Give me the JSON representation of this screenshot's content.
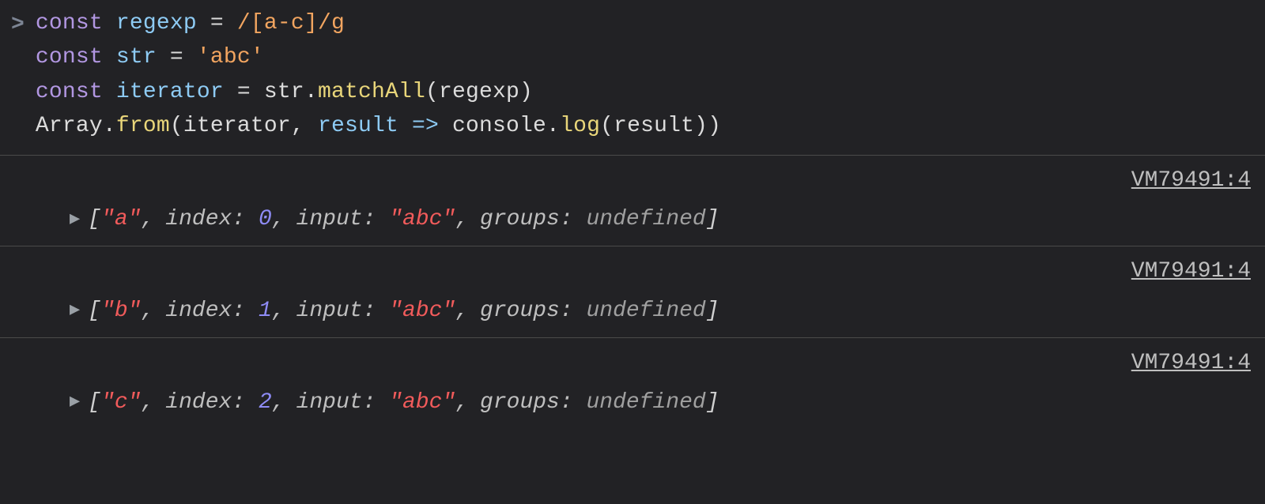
{
  "input": {
    "line1": {
      "kw1": "const",
      "v1": "regexp",
      "eq": "=",
      "regex": "/[a-c]/g"
    },
    "line2": {
      "kw1": "const",
      "v1": "str",
      "eq": "=",
      "str": "'abc'"
    },
    "line3": {
      "kw1": "const",
      "v1": "iterator",
      "eq": "=",
      "obj": "str",
      "dot": ".",
      "fn": "matchAll",
      "open": "(",
      "arg": "regexp",
      "close": ")"
    },
    "line4": {
      "obj": "Array",
      "dot1": ".",
      "fn1": "from",
      "open": "(",
      "arg1": "iterator",
      "c": ",",
      "arg2": "result",
      "arrow": "=>",
      "obj2": "console",
      "dot2": ".",
      "fn2": "log",
      "open2": "(",
      "arg3": "result",
      "close2": ")",
      "close": ")"
    }
  },
  "source_link": "VM79491:4",
  "logs": [
    {
      "match": "\"a\"",
      "index": "0",
      "input": "\"abc\"",
      "groups": "undefined"
    },
    {
      "match": "\"b\"",
      "index": "1",
      "input": "\"abc\"",
      "groups": "undefined"
    },
    {
      "match": "\"c\"",
      "index": "2",
      "input": "\"abc\"",
      "groups": "undefined"
    }
  ],
  "labels": {
    "index": "index:",
    "input": "input:",
    "groups": "groups:"
  },
  "prompt": ">"
}
